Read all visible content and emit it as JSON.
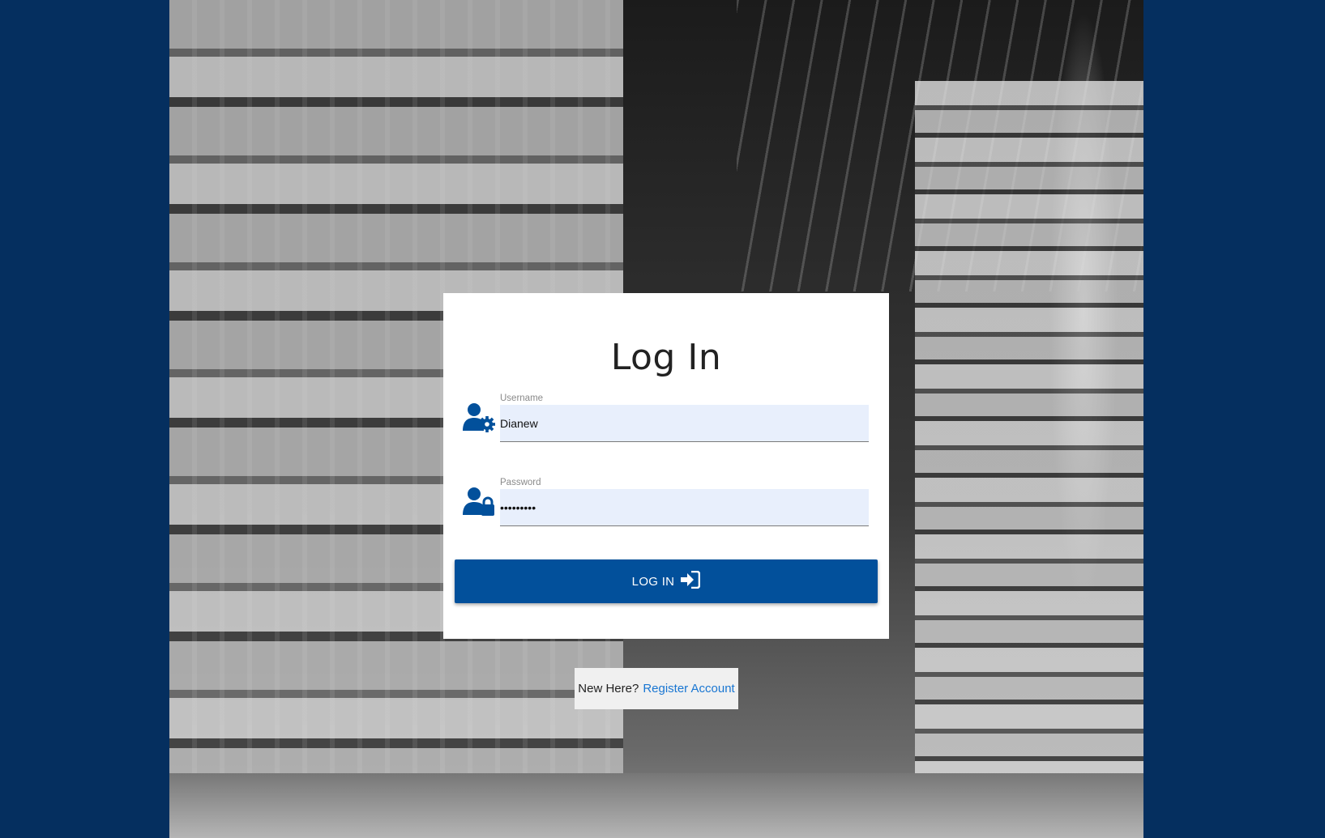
{
  "login": {
    "title": "Log In",
    "username": {
      "label": "Username",
      "value": "Dianew",
      "icon": "user-gear-icon"
    },
    "password": {
      "label": "Password",
      "value": "•••••••••",
      "icon": "user-lock-icon"
    },
    "button_label": "LOG IN",
    "button_icon": "sign-in-icon"
  },
  "register": {
    "prompt": "New Here?",
    "link_label": "Register Account"
  },
  "colors": {
    "page_background": "#052f5f",
    "primary": "#02509b",
    "input_background": "#e8effc",
    "link": "#1976d2"
  }
}
